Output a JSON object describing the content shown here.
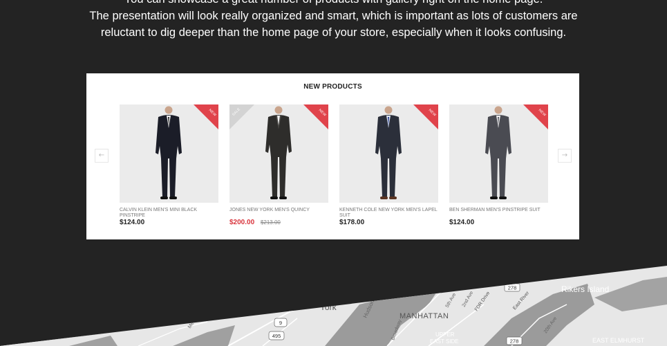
{
  "intro": {
    "line1": "You can showcase a great number of products with gallery right on the home page.",
    "line2": "The presentation will look really organized and smart, which is important as lots of customers are",
    "line3": "reluctant to dig deeper than the home page of your store, especially when it looks confusing."
  },
  "widget": {
    "title": "NEW PRODUCTS",
    "prev_icon": "←",
    "next_icon": "→",
    "ribbon_color": "#e0434b",
    "sale_ribbon_color": "#d3d3d3",
    "products": [
      {
        "name": "CALVIN KLEIN MEN'S MINI BLACK PINSTRIPE",
        "price": "$124.00",
        "old_price": "",
        "badges": [
          "NEW"
        ],
        "suit_color": "#1b1d28"
      },
      {
        "name": "JONES NEW YORK MEN'S QUINCY",
        "price": "$200.00",
        "old_price": "$213.00",
        "badges": [
          "SALE",
          "NEW"
        ],
        "suit_color": "#2e2d2b"
      },
      {
        "name": "KENNETH COLE NEW YORK MEN'S LAPEL SUIT",
        "price": "$178.00",
        "old_price": "",
        "badges": [
          "NEW"
        ],
        "suit_color": "#2b2f3a"
      },
      {
        "name": "BEN SHERMAN MEN'S PINSTRIPE SUIT",
        "price": "$124.00",
        "old_price": "",
        "badges": [
          "NEW"
        ],
        "suit_color": "#4a4b52"
      }
    ]
  },
  "map": {
    "labels": {
      "rikers": "Rikers Island",
      "york": "York",
      "manhattan": "MANHATTAN",
      "upper": "UPPER",
      "east_side": "EAST SIDE",
      "east_elmhurst": "EAST ELMHURST",
      "hudson": "Hudson R",
      "fdr": "FDR Drive",
      "east_river": "East River",
      "fifth": "5th Ave",
      "second": "2nd Ave",
      "twentieth": "20th Ave",
      "broadway": "Broadway",
      "meadow": "Meado",
      "new": "New"
    },
    "shields": {
      "i278_top": "278",
      "i278_bottom": "278",
      "r9": "9",
      "i495": "495"
    }
  }
}
